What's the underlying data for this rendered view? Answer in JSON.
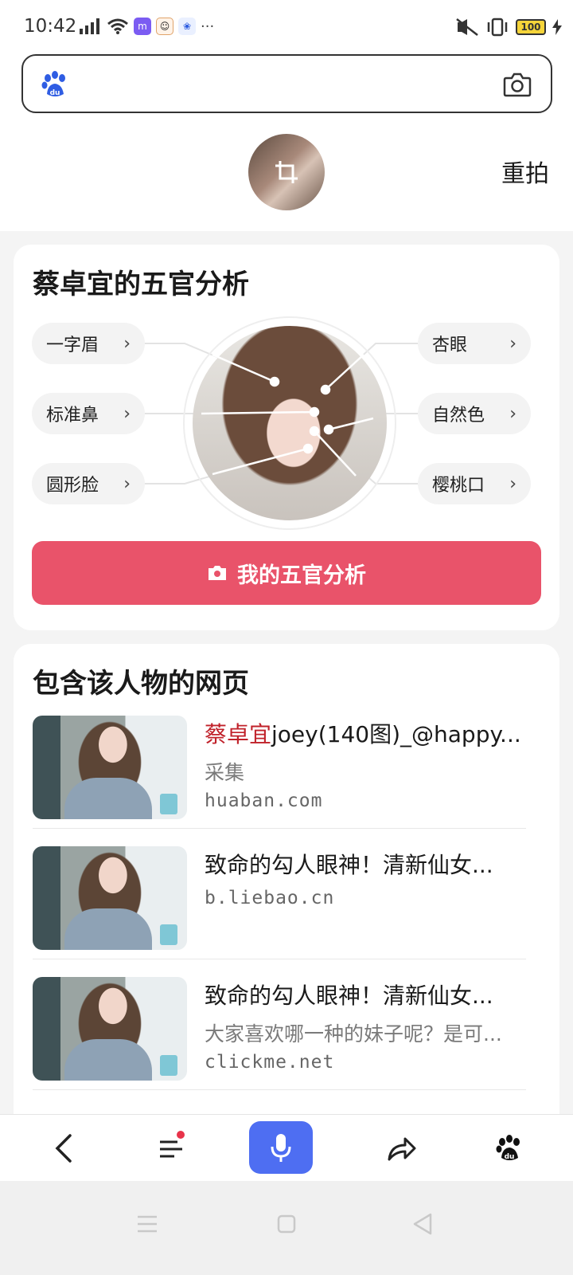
{
  "status_bar": {
    "time": "10:42",
    "battery": "100",
    "more": "···"
  },
  "search": {
    "left_icon": "baidu-paw-icon",
    "right_icon": "camera-icon"
  },
  "header": {
    "retake_label": "重拍",
    "avatar_icon": "crop-icon"
  },
  "analysis": {
    "title": "蔡卓宜的五官分析",
    "features_left": [
      {
        "label": "一字眉"
      },
      {
        "label": "标准鼻"
      },
      {
        "label": "圆形脸"
      }
    ],
    "features_right": [
      {
        "label": "杏眼"
      },
      {
        "label": "自然色"
      },
      {
        "label": "樱桃口"
      }
    ],
    "button_label": "我的五官分析",
    "accent_color": "#e9536a"
  },
  "pages": {
    "title": "包含该人物的网页",
    "results": [
      {
        "title_highlight": "蔡卓宜",
        "title_rest": "joey(140图)_@happy...",
        "desc": "采集",
        "source": "huaban.com"
      },
      {
        "title_highlight": "",
        "title_rest": "致命的勾人眼神！清新仙女...",
        "desc": "",
        "source": "b.liebao.cn"
      },
      {
        "title_highlight": "",
        "title_rest": "致命的勾人眼神！清新仙女...",
        "desc": "大家喜欢哪一种的妹子呢？是可...",
        "source": "clickme.net"
      }
    ]
  },
  "toolbar": {
    "items": [
      "back-icon",
      "menu-icon",
      "mic-icon",
      "share-icon",
      "baidu-paw-icon"
    ],
    "mic_color": "#4e6ef2"
  }
}
